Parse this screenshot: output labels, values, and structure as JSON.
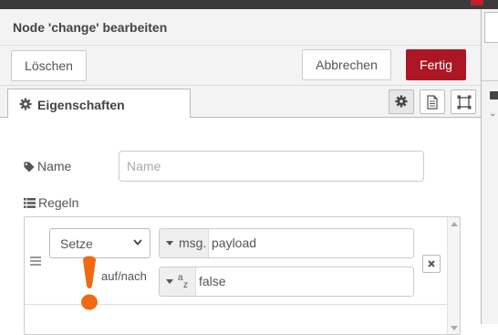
{
  "dialog": {
    "title": "Node 'change' bearbeiten",
    "delete_label": "Löschen",
    "cancel_label": "Abbrechen",
    "done_label": "Fertig"
  },
  "tabs": {
    "properties_label": "Eigenschaften",
    "icons": [
      "gear-icon",
      "description-icon",
      "appearance-icon"
    ]
  },
  "form": {
    "name_label": "Name",
    "name_placeholder": "Name",
    "name_value": "",
    "rules_label": "Regeln"
  },
  "rule": {
    "action": "Setze",
    "target_type": "msg.",
    "target_value": "payload",
    "to_label": "auf/nach",
    "value_type_icon": "az-string-icon",
    "value": "false"
  },
  "colors": {
    "primary_button": "#ad1625",
    "annotation_mark": "#f06a12",
    "header_bg": "#f3f3f3"
  }
}
